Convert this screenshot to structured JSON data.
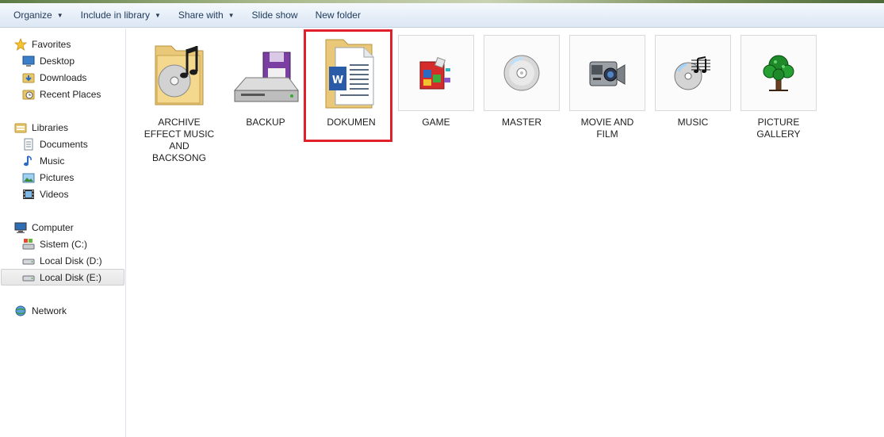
{
  "toolbar": {
    "organize": "Organize",
    "include_in_library": "Include in library",
    "share_with": "Share with",
    "slide_show": "Slide show",
    "new_folder": "New folder"
  },
  "sidebar": {
    "favorites": {
      "label": "Favorites",
      "items": [
        "Desktop",
        "Downloads",
        "Recent Places"
      ]
    },
    "libraries": {
      "label": "Libraries",
      "items": [
        "Documents",
        "Music",
        "Pictures",
        "Videos"
      ]
    },
    "computer": {
      "label": "Computer",
      "items": [
        "Sistem (C:)",
        "Local Disk (D:)",
        "Local Disk (E:)"
      ],
      "selected": "Local Disk (E:)"
    },
    "network": {
      "label": "Network"
    }
  },
  "folders": [
    {
      "label": "ARCHIVE EFFECT MUSIC AND BACKSONG",
      "icon": "music-folder-icon"
    },
    {
      "label": "BACKUP",
      "icon": "disk-drive-icon"
    },
    {
      "label": "DOKUMEN",
      "icon": "documents-folder-icon",
      "highlighted": true
    },
    {
      "label": "GAME",
      "icon": "game-icon"
    },
    {
      "label": "MASTER",
      "icon": "cd-icon"
    },
    {
      "label": "MOVIE AND FILM",
      "icon": "camcorder-icon"
    },
    {
      "label": "MUSIC",
      "icon": "music-cd-icon"
    },
    {
      "label": "PICTURE GALLERY",
      "icon": "tree-icon"
    }
  ],
  "colors": {
    "highlight_border": "#e0202a",
    "toolbar_text": "#1e395b"
  }
}
